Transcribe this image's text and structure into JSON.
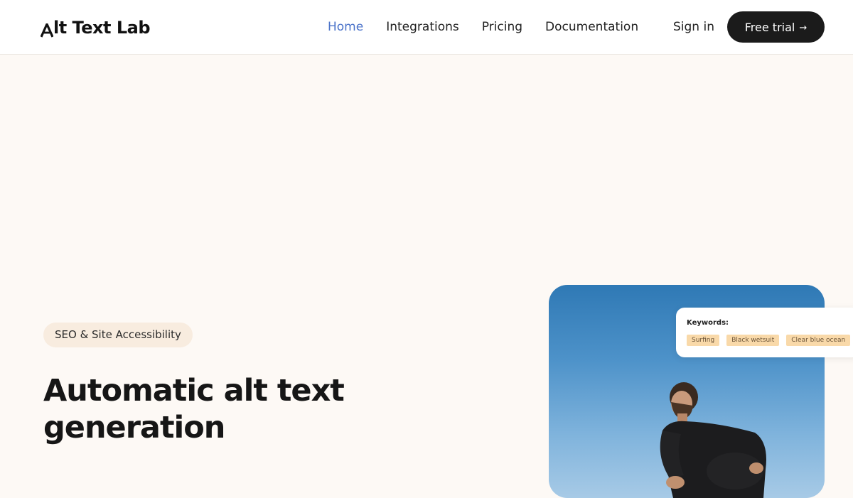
{
  "header": {
    "logo_text": "lt Text Lab",
    "nav": [
      {
        "label": "Home",
        "active": true
      },
      {
        "label": "Integrations",
        "active": false
      },
      {
        "label": "Pricing",
        "active": false
      },
      {
        "label": "Documentation",
        "active": false
      }
    ],
    "signin_label": "Sign in",
    "cta_label": "Free trial",
    "cta_arrow": "→"
  },
  "hero": {
    "badge": "SEO & Site Accessibility",
    "title": "Automatic alt text generation"
  },
  "keywords_card": {
    "title": "Keywords:",
    "tags": [
      "Surfing",
      "Black wetsuit",
      "Clear blue ocean"
    ]
  },
  "colors": {
    "accent_nav": "#4a72c9",
    "cta_bg": "#1b1b1b",
    "page_bg": "#fdf9f5",
    "badge_bg": "#f8ecdf",
    "keyword_bg": "#f9d9a9"
  }
}
